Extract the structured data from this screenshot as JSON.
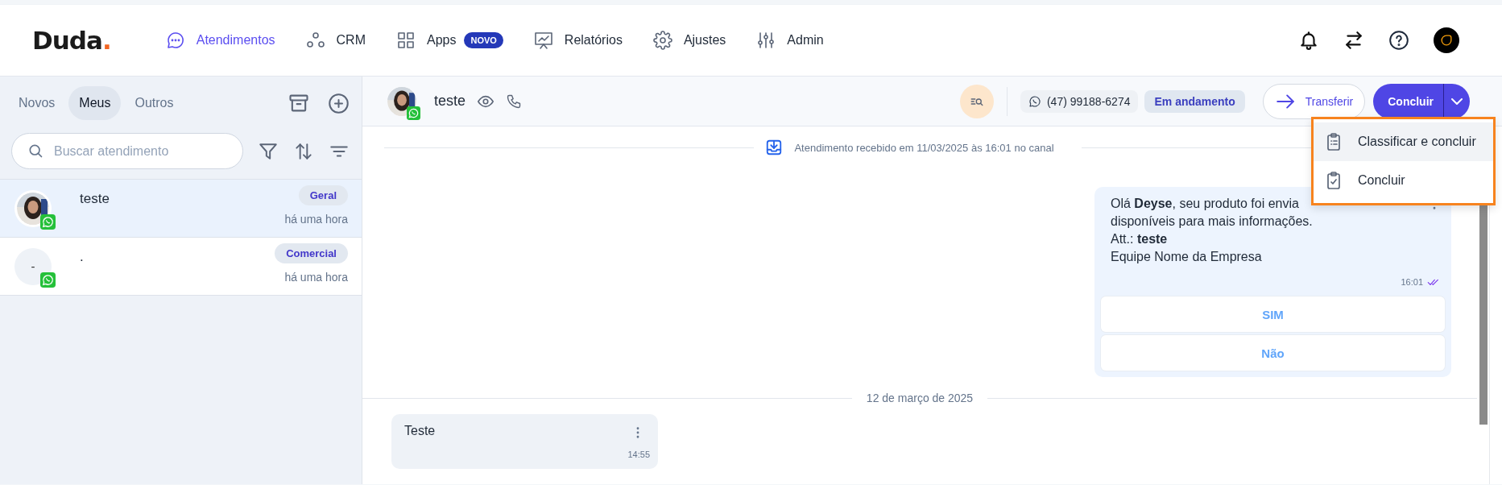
{
  "brand": {
    "logo": "Duda",
    "logo_mark": "."
  },
  "nav": [
    {
      "label": "Atendimentos",
      "selected": true
    },
    {
      "label": "CRM",
      "selected": false
    },
    {
      "label": "Apps",
      "selected": false,
      "badge": "NOVO"
    },
    {
      "label": "Relatórios",
      "selected": false
    },
    {
      "label": "Ajustes",
      "selected": false
    },
    {
      "label": "Admin",
      "selected": false
    }
  ],
  "sidebar": {
    "tabs": [
      {
        "label": "Novos",
        "selected": false
      },
      {
        "label": "Meus",
        "selected": true
      },
      {
        "label": "Outros",
        "selected": false
      }
    ],
    "search": {
      "placeholder": "Buscar atendimento"
    },
    "conversations": [
      {
        "name": "teste",
        "tag": "Geral",
        "time": "há uma hora",
        "selected": true
      },
      {
        "name": ".",
        "tag": "Comercial",
        "time": "há uma hora",
        "selected": false,
        "avatar": {
          "kind": "initials",
          "text": "-"
        }
      }
    ]
  },
  "chat": {
    "contact": "teste",
    "phone": "(47) 99188-6274",
    "status": "Em andamento",
    "transfer": "Transferir",
    "conclude": "Concluir",
    "timeline": [
      {
        "kind": "system",
        "text": "Atendimento recebido em 11/03/2025 às 16:01 no canal"
      },
      {
        "kind": "message",
        "outgoing": true,
        "lines": [
          "Olá **Deyse**, seu produto foi envia",
          "disponíveis para mais informações.",
          "Att.: **teste**",
          "Equipe Nome da Empresa"
        ],
        "time": "16:01",
        "read": true,
        "quick_replies": [
          "SIM",
          "Não"
        ]
      },
      {
        "kind": "date",
        "text": "12 de março de 2025"
      },
      {
        "kind": "message",
        "outgoing": false,
        "lines": [
          "Teste"
        ],
        "time": "14:55"
      }
    ]
  },
  "menu": {
    "items": [
      {
        "label": "Classificar e concluir",
        "selected": true
      },
      {
        "label": "Concluir",
        "selected": false
      }
    ]
  }
}
